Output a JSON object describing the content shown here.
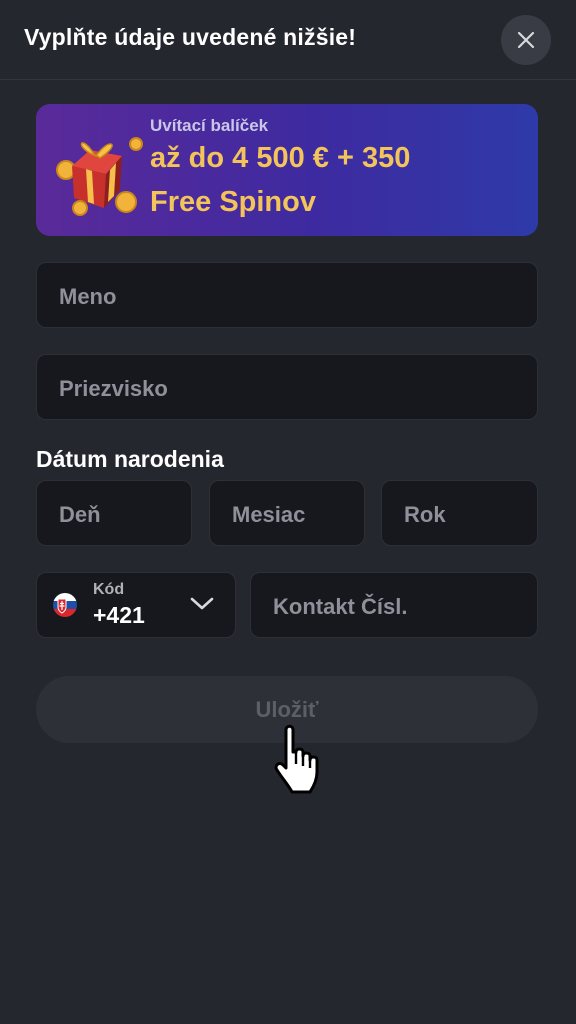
{
  "header": {
    "title": "Vyplňte údaje uvedené nižšie!",
    "close_icon": "close-icon"
  },
  "banner": {
    "subtitle": "Uvítací balíček",
    "line1": "až do 4 500 € + 350",
    "line2": "Free Spinov",
    "icon": "gift-icon",
    "colors": {
      "accent": "#f2c45a",
      "gradient_start": "#5a2a9a",
      "gradient_end": "#2e3aa8"
    }
  },
  "form": {
    "first_name": {
      "placeholder": "Meno",
      "value": ""
    },
    "last_name": {
      "placeholder": "Priezvisko",
      "value": ""
    },
    "dob": {
      "label": "Dátum narodenia",
      "day": {
        "placeholder": "Deň"
      },
      "month": {
        "placeholder": "Mesiac"
      },
      "year": {
        "placeholder": "Rok"
      }
    },
    "phone": {
      "code_label": "Kód",
      "code_value": "+421",
      "flag_icon": "slovakia-flag-icon",
      "placeholder": "Kontakt Čísl."
    },
    "save_label": "Uložiť"
  },
  "colors": {
    "background": "#25272f",
    "field_bg": "#17181d",
    "placeholder": "#8e909a",
    "button_disabled": "#2e3038"
  }
}
